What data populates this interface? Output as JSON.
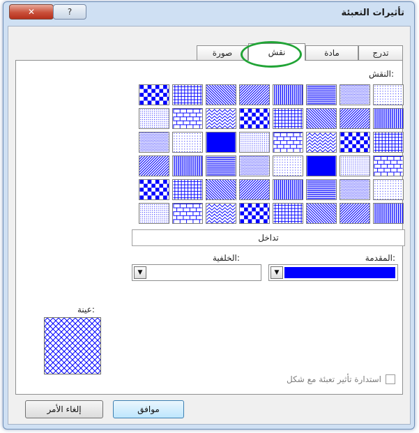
{
  "window": {
    "title": "تأثيرات التعبئة",
    "close_glyph": "✕",
    "help_glyph": "?"
  },
  "tabs": [
    {
      "label": "تدرج"
    },
    {
      "label": "مادة"
    },
    {
      "label": "نقش"
    },
    {
      "label": "صورة"
    }
  ],
  "active_tab": "نقش",
  "pattern": {
    "section_label": "النقش:",
    "selected_name": "تداخل",
    "foreground_label": "المقدمة:",
    "background_label": "الخلفية:",
    "foreground_color": "#0000ff",
    "background_color": "#ffffff",
    "pattern_color": "#0000ff"
  },
  "sample": {
    "label": "عينة:"
  },
  "rotate_checkbox": {
    "label": "استدارة تأثير تعبئة مع شكل",
    "checked": false
  },
  "buttons": {
    "ok": "موافق",
    "cancel": "إلغاء الأمر"
  }
}
